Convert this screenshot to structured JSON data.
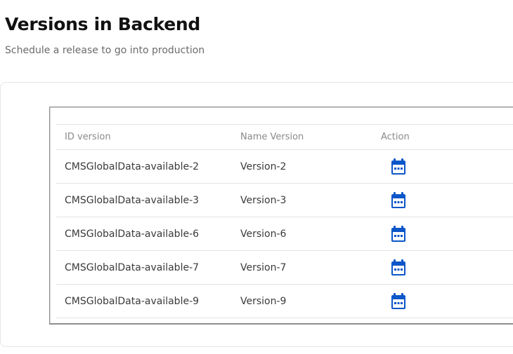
{
  "header": {
    "title": "Versions in Backend",
    "subtitle": "Schedule a release to go into production"
  },
  "table": {
    "columns": [
      "ID version",
      "Name Version",
      "Action"
    ],
    "rows": [
      {
        "id": "CMSGlobalData-available-2",
        "name": "Version-2",
        "action_icon": "calendar-icon"
      },
      {
        "id": "CMSGlobalData-available-3",
        "name": "Version-3",
        "action_icon": "calendar-icon"
      },
      {
        "id": "CMSGlobalData-available-6",
        "name": "Version-6",
        "action_icon": "calendar-icon"
      },
      {
        "id": "CMSGlobalData-available-7",
        "name": "Version-7",
        "action_icon": "calendar-icon"
      },
      {
        "id": "CMSGlobalData-available-9",
        "name": "Version-9",
        "action_icon": "calendar-icon"
      }
    ]
  },
  "colors": {
    "icon": "#0b56c9",
    "title": "#111111",
    "subtitle": "#6b6b6b"
  }
}
